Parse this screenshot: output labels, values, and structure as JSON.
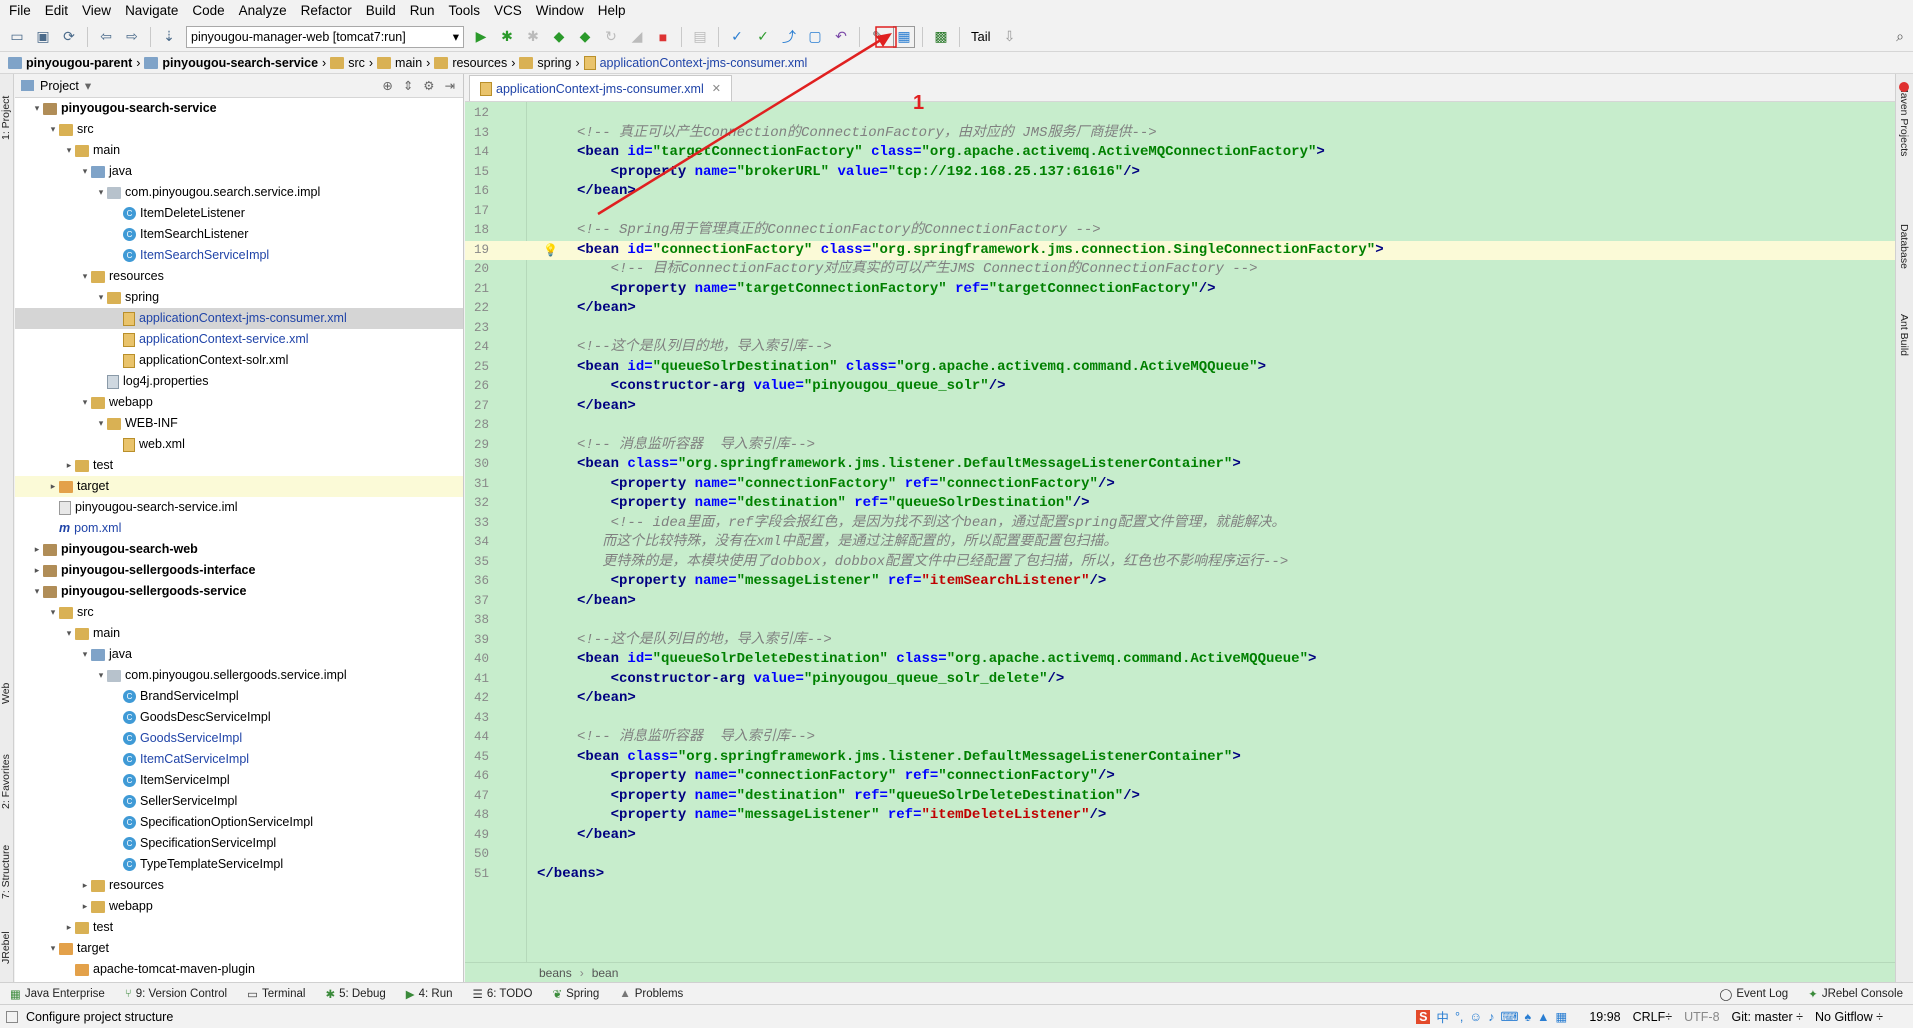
{
  "menu": [
    "File",
    "Edit",
    "View",
    "Navigate",
    "Code",
    "Analyze",
    "Refactor",
    "Build",
    "Run",
    "Tools",
    "VCS",
    "Window",
    "Help"
  ],
  "toolbar": {
    "run_config": "pinyougou-manager-web [tomcat7:run]",
    "tail_label": "Tail"
  },
  "breadcrumb": [
    "pinyougou-parent",
    "pinyougou-search-service",
    "src",
    "main",
    "resources",
    "spring",
    "applicationContext-jms-consumer.xml"
  ],
  "left_tool_windows": [
    "1: Project",
    "Web",
    "2: Favorites",
    "7: Structure",
    "JRebel"
  ],
  "right_tool_windows": [
    "Maven Projects",
    "Database",
    "Ant Build"
  ],
  "project_panel": {
    "title": "Project"
  },
  "tree": [
    {
      "indent": 0,
      "arrow": "▾",
      "icon": "module",
      "label": "pinyougou-search-service",
      "bold": true
    },
    {
      "indent": 1,
      "arrow": "▾",
      "icon": "folder",
      "label": "src"
    },
    {
      "indent": 2,
      "arrow": "▾",
      "icon": "folder",
      "label": "main"
    },
    {
      "indent": 3,
      "arrow": "▾",
      "icon": "folder-blue",
      "label": "java"
    },
    {
      "indent": 4,
      "arrow": "▾",
      "icon": "package",
      "label": "com.pinyougou.search.service.impl"
    },
    {
      "indent": 5,
      "arrow": "",
      "icon": "class",
      "label": "ItemDeleteListener"
    },
    {
      "indent": 5,
      "arrow": "",
      "icon": "class",
      "label": "ItemSearchListener"
    },
    {
      "indent": 5,
      "arrow": "",
      "icon": "class",
      "label": "ItemSearchServiceImpl",
      "blue": true
    },
    {
      "indent": 3,
      "arrow": "▾",
      "icon": "folder",
      "label": "resources"
    },
    {
      "indent": 4,
      "arrow": "▾",
      "icon": "folder",
      "label": "spring"
    },
    {
      "indent": 5,
      "arrow": "",
      "icon": "xml",
      "label": "applicationContext-jms-consumer.xml",
      "blue": true,
      "sel": true
    },
    {
      "indent": 5,
      "arrow": "",
      "icon": "xml",
      "label": "applicationContext-service.xml",
      "blue": true
    },
    {
      "indent": 5,
      "arrow": "",
      "icon": "xml",
      "label": "applicationContext-solr.xml"
    },
    {
      "indent": 4,
      "arrow": "",
      "icon": "props",
      "label": "log4j.properties"
    },
    {
      "indent": 3,
      "arrow": "▾",
      "icon": "folder",
      "label": "webapp"
    },
    {
      "indent": 4,
      "arrow": "▾",
      "icon": "folder",
      "label": "WEB-INF"
    },
    {
      "indent": 5,
      "arrow": "",
      "icon": "xml",
      "label": "web.xml"
    },
    {
      "indent": 2,
      "arrow": "▸",
      "icon": "folder",
      "label": "test"
    },
    {
      "indent": 1,
      "arrow": "▸",
      "icon": "folder-orange",
      "label": "target",
      "hl": true
    },
    {
      "indent": 1,
      "arrow": "",
      "icon": "iml",
      "label": "pinyougou-search-service.iml"
    },
    {
      "indent": 1,
      "arrow": "",
      "icon": "maven",
      "label": "pom.xml",
      "blue": true
    },
    {
      "indent": 0,
      "arrow": "▸",
      "icon": "module",
      "label": "pinyougou-search-web",
      "bold": true
    },
    {
      "indent": 0,
      "arrow": "▸",
      "icon": "module",
      "label": "pinyougou-sellergoods-interface",
      "bold": true
    },
    {
      "indent": 0,
      "arrow": "▾",
      "icon": "module",
      "label": "pinyougou-sellergoods-service",
      "bold": true
    },
    {
      "indent": 1,
      "arrow": "▾",
      "icon": "folder",
      "label": "src"
    },
    {
      "indent": 2,
      "arrow": "▾",
      "icon": "folder",
      "label": "main"
    },
    {
      "indent": 3,
      "arrow": "▾",
      "icon": "folder-blue",
      "label": "java"
    },
    {
      "indent": 4,
      "arrow": "▾",
      "icon": "package",
      "label": "com.pinyougou.sellergoods.service.impl"
    },
    {
      "indent": 5,
      "arrow": "",
      "icon": "class",
      "label": "BrandServiceImpl"
    },
    {
      "indent": 5,
      "arrow": "",
      "icon": "class",
      "label": "GoodsDescServiceImpl"
    },
    {
      "indent": 5,
      "arrow": "",
      "icon": "class",
      "label": "GoodsServiceImpl",
      "blue": true
    },
    {
      "indent": 5,
      "arrow": "",
      "icon": "class",
      "label": "ItemCatServiceImpl",
      "blue": true
    },
    {
      "indent": 5,
      "arrow": "",
      "icon": "class",
      "label": "ItemServiceImpl"
    },
    {
      "indent": 5,
      "arrow": "",
      "icon": "class",
      "label": "SellerServiceImpl"
    },
    {
      "indent": 5,
      "arrow": "",
      "icon": "class",
      "label": "SpecificationOptionServiceImpl"
    },
    {
      "indent": 5,
      "arrow": "",
      "icon": "class",
      "label": "SpecificationServiceImpl"
    },
    {
      "indent": 5,
      "arrow": "",
      "icon": "class",
      "label": "TypeTemplateServiceImpl"
    },
    {
      "indent": 3,
      "arrow": "▸",
      "icon": "folder",
      "label": "resources"
    },
    {
      "indent": 3,
      "arrow": "▸",
      "icon": "folder",
      "label": "webapp"
    },
    {
      "indent": 2,
      "arrow": "▸",
      "icon": "folder",
      "label": "test"
    },
    {
      "indent": 1,
      "arrow": "▾",
      "icon": "folder-orange",
      "label": "target"
    },
    {
      "indent": 2,
      "arrow": "",
      "icon": "folder-orange",
      "label": "apache-tomcat-maven-plugin"
    }
  ],
  "editor_tab": "applicationContext-jms-consumer.xml",
  "annotation_number": "1",
  "code_lines": [
    {
      "n": "12",
      "html": ""
    },
    {
      "n": "13",
      "html": "<span class='c'>&lt;!-- 真正可以产生Connection的ConnectionFactory，由对应的 JMS服务厂商提供--&gt;</span>"
    },
    {
      "n": "14",
      "html": "<span class='t'>&lt;bean </span><span class='a'>id=</span><span class='v'>\"targetConnectionFactory\"</span> <span class='a'>class=</span><span class='v'>\"org.apache.activemq.ActiveMQConnectionFactory\"</span><span class='t'>&gt;</span>"
    },
    {
      "n": "15",
      "html": "    <span class='t'>&lt;property </span><span class='a'>name=</span><span class='v'>\"brokerURL\"</span> <span class='a'>value=</span><span class='v'>\"tcp://192.168.25.137:61616\"</span><span class='t'>/&gt;</span>"
    },
    {
      "n": "16",
      "html": "<span class='t'>&lt;/bean&gt;</span>"
    },
    {
      "n": "17",
      "html": ""
    },
    {
      "n": "18",
      "html": "<span class='c'>&lt;!-- Spring用于管理真正的ConnectionFactory的ConnectionFactory --&gt;</span>"
    },
    {
      "n": "19",
      "html": "<span class='t'>&lt;bean </span><span class='a'>id=</span><span class='v'>\"connectionFactory\"</span> <span class='a'>class=</span><span class='v'>\"org.springframework.jms.connection.SingleConnectionFactory\"</span><span class='t'>&gt;</span>",
      "cur": true
    },
    {
      "n": "20",
      "html": "    <span class='c'>&lt;!-- 目标ConnectionFactory对应真实的可以产生JMS Connection的ConnectionFactory --&gt;</span>"
    },
    {
      "n": "21",
      "html": "    <span class='t'>&lt;property </span><span class='a'>name=</span><span class='v'>\"targetConnectionFactory\"</span> <span class='a'>ref=</span><span class='v'>\"targetConnectionFactory\"</span><span class='t'>/&gt;</span>"
    },
    {
      "n": "22",
      "html": "<span class='t'>&lt;/bean&gt;</span>"
    },
    {
      "n": "23",
      "html": ""
    },
    {
      "n": "24",
      "html": "<span class='c'>&lt;!--这个是队列目的地，导入索引库--&gt;</span>"
    },
    {
      "n": "25",
      "html": "<span class='t'>&lt;bean </span><span class='a'>id=</span><span class='v'>\"queueSolrDestination\"</span> <span class='a'>class=</span><span class='v'>\"org.apache.activemq.command.ActiveMQQueue\"</span><span class='t'>&gt;</span>"
    },
    {
      "n": "26",
      "html": "    <span class='t'>&lt;constructor-arg </span><span class='a'>value=</span><span class='v'>\"pinyougou_queue_solr\"</span><span class='t'>/&gt;</span>"
    },
    {
      "n": "27",
      "html": "<span class='t'>&lt;/bean&gt;</span>"
    },
    {
      "n": "28",
      "html": ""
    },
    {
      "n": "29",
      "html": "<span class='c'>&lt;!-- 消息监听容器  导入索引库--&gt;</span>"
    },
    {
      "n": "30",
      "html": "<span class='t'>&lt;bean </span><span class='a'>class=</span><span class='v'>\"org.springframework.jms.listener.DefaultMessageListenerContainer\"</span><span class='t'>&gt;</span>"
    },
    {
      "n": "31",
      "html": "    <span class='t'>&lt;property </span><span class='a'>name=</span><span class='v'>\"connectionFactory\"</span> <span class='a'>ref=</span><span class='v'>\"connectionFactory\"</span><span class='t'>/&gt;</span>"
    },
    {
      "n": "32",
      "html": "    <span class='t'>&lt;property </span><span class='a'>name=</span><span class='v'>\"destination\"</span> <span class='a'>ref=</span><span class='v'>\"queueSolrDestination\"</span><span class='t'>/&gt;</span>"
    },
    {
      "n": "33",
      "html": "    <span class='c'>&lt;!-- idea里面，ref字段会报红色，是因为找不到这个bean，通过配置spring配置文件管理，就能解决。</span>"
    },
    {
      "n": "34",
      "html": "<span class='c'>   而这个比较特殊，没有在xml中配置，是通过注解配置的，所以配置要配置包扫描。</span>"
    },
    {
      "n": "35",
      "html": "<span class='c'>   更特殊的是，本模块使用了dobbox，dobbox配置文件中已经配置了包扫描，所以，红色也不影响程序运行--&gt;</span>"
    },
    {
      "n": "36",
      "html": "    <span class='t'>&lt;property </span><span class='a'>name=</span><span class='v'>\"messageListener\"</span> <span class='a'>ref=</span><span class='vr'>\"itemSearchListener\"</span><span class='t'>/&gt;</span>"
    },
    {
      "n": "37",
      "html": "<span class='t'>&lt;/bean&gt;</span>"
    },
    {
      "n": "38",
      "html": ""
    },
    {
      "n": "39",
      "html": "<span class='c'>&lt;!--这个是队列目的地，导入索引库--&gt;</span>"
    },
    {
      "n": "40",
      "html": "<span class='t'>&lt;bean </span><span class='a'>id=</span><span class='v'>\"queueSolrDeleteDestination\"</span> <span class='a'>class=</span><span class='v'>\"org.apache.activemq.command.ActiveMQQueue\"</span><span class='t'>&gt;</span>"
    },
    {
      "n": "41",
      "html": "    <span class='t'>&lt;constructor-arg </span><span class='a'>value=</span><span class='v'>\"pinyougou_queue_solr_delete\"</span><span class='t'>/&gt;</span>"
    },
    {
      "n": "42",
      "html": "<span class='t'>&lt;/bean&gt;</span>"
    },
    {
      "n": "43",
      "html": ""
    },
    {
      "n": "44",
      "html": "<span class='c'>&lt;!-- 消息监听容器  导入索引库--&gt;</span>"
    },
    {
      "n": "45",
      "html": "<span class='t'>&lt;bean </span><span class='a'>class=</span><span class='v'>\"org.springframework.jms.listener.DefaultMessageListenerContainer\"</span><span class='t'>&gt;</span>"
    },
    {
      "n": "46",
      "html": "    <span class='t'>&lt;property </span><span class='a'>name=</span><span class='v'>\"connectionFactory\"</span> <span class='a'>ref=</span><span class='v'>\"connectionFactory\"</span><span class='t'>/&gt;</span>"
    },
    {
      "n": "47",
      "html": "    <span class='t'>&lt;property </span><span class='a'>name=</span><span class='v'>\"destination\"</span> <span class='a'>ref=</span><span class='v'>\"queueSolrDeleteDestination\"</span><span class='t'>/&gt;</span>"
    },
    {
      "n": "48",
      "html": "    <span class='t'>&lt;property </span><span class='a'>name=</span><span class='v'>\"messageListener\"</span> <span class='a'>ref=</span><span class='vr'>\"itemDeleteListener\"</span><span class='t'>/&gt;</span>"
    },
    {
      "n": "49",
      "html": "<span class='t'>&lt;/bean&gt;</span>"
    },
    {
      "n": "50",
      "html": ""
    },
    {
      "n": "51",
      "html": "<span class='t'>&lt;/beans&gt;</span>",
      "outdent": true
    }
  ],
  "editor_crumbs": [
    "beans",
    "bean"
  ],
  "bottom_tools": [
    "Java Enterprise",
    "9: Version Control",
    "Terminal",
    "5: Debug",
    "4: Run",
    "6: TODO",
    "Spring",
    "Problems"
  ],
  "bottom_right_tools": [
    "Event Log",
    "JRebel Console"
  ],
  "status": {
    "message": "Configure project structure",
    "position": "19:98",
    "line_sep": "CRLF÷",
    "encoding": "UTF-8",
    "git": "Git: master ÷",
    "gitflow": "No Gitflow ÷"
  }
}
